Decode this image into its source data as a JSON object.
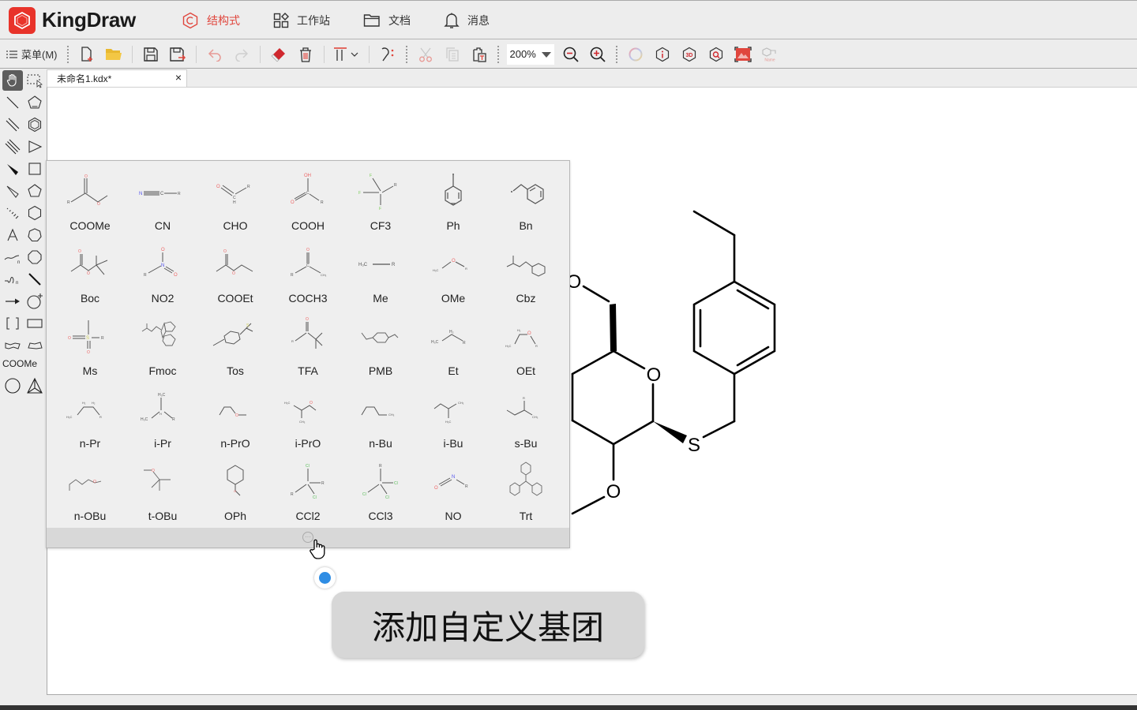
{
  "app": {
    "name": "KingDraw",
    "brand_color": "#e8332a"
  },
  "nav": [
    {
      "label": "结构式",
      "icon": "structure-icon",
      "active": true
    },
    {
      "label": "工作站",
      "icon": "workstation-icon",
      "active": false
    },
    {
      "label": "文档",
      "icon": "folder-icon",
      "active": false
    },
    {
      "label": "消息",
      "icon": "bell-icon",
      "active": false
    }
  ],
  "toolbar": {
    "menu_label": "菜单(M)",
    "zoom_level": "200%",
    "buttons": [
      "new-file",
      "open-file",
      "save",
      "save-as",
      "undo",
      "redo",
      "eraser",
      "delete",
      "text-style",
      "clean-structure",
      "cut",
      "copy",
      "paste",
      "zoom-out",
      "zoom-in",
      "color-ring",
      "info",
      "3d-view",
      "search-structure",
      "image-recognize",
      "name-to-structure"
    ]
  },
  "palette": {
    "template_label": "COOMe"
  },
  "document_tab": {
    "title": "未命名1.kdx*",
    "close_label": "×"
  },
  "groups": [
    {
      "label": "COOMe"
    },
    {
      "label": "CN"
    },
    {
      "label": "CHO"
    },
    {
      "label": "COOH"
    },
    {
      "label": "CF3"
    },
    {
      "label": "Ph"
    },
    {
      "label": "Bn"
    },
    {
      "label": "Boc"
    },
    {
      "label": "NO2"
    },
    {
      "label": "COOEt"
    },
    {
      "label": "COCH3"
    },
    {
      "label": "Me"
    },
    {
      "label": "OMe"
    },
    {
      "label": "Cbz"
    },
    {
      "label": "Ms"
    },
    {
      "label": "Fmoc"
    },
    {
      "label": "Tos"
    },
    {
      "label": "TFA"
    },
    {
      "label": "PMB"
    },
    {
      "label": "Et"
    },
    {
      "label": "OEt"
    },
    {
      "label": "n-Pr"
    },
    {
      "label": "i-Pr"
    },
    {
      "label": "n-PrO"
    },
    {
      "label": "i-PrO"
    },
    {
      "label": "n-Bu"
    },
    {
      "label": "i-Bu"
    },
    {
      "label": "s-Bu"
    },
    {
      "label": "n-OBu"
    },
    {
      "label": "t-OBu"
    },
    {
      "label": "OPh"
    },
    {
      "label": "CCl2"
    },
    {
      "label": "CCl3"
    },
    {
      "label": "NO"
    },
    {
      "label": "Trt"
    }
  ],
  "molecule": {
    "atoms": [
      "O",
      "O",
      "S",
      "O"
    ]
  },
  "caption": {
    "text": "添加自定义基团"
  }
}
